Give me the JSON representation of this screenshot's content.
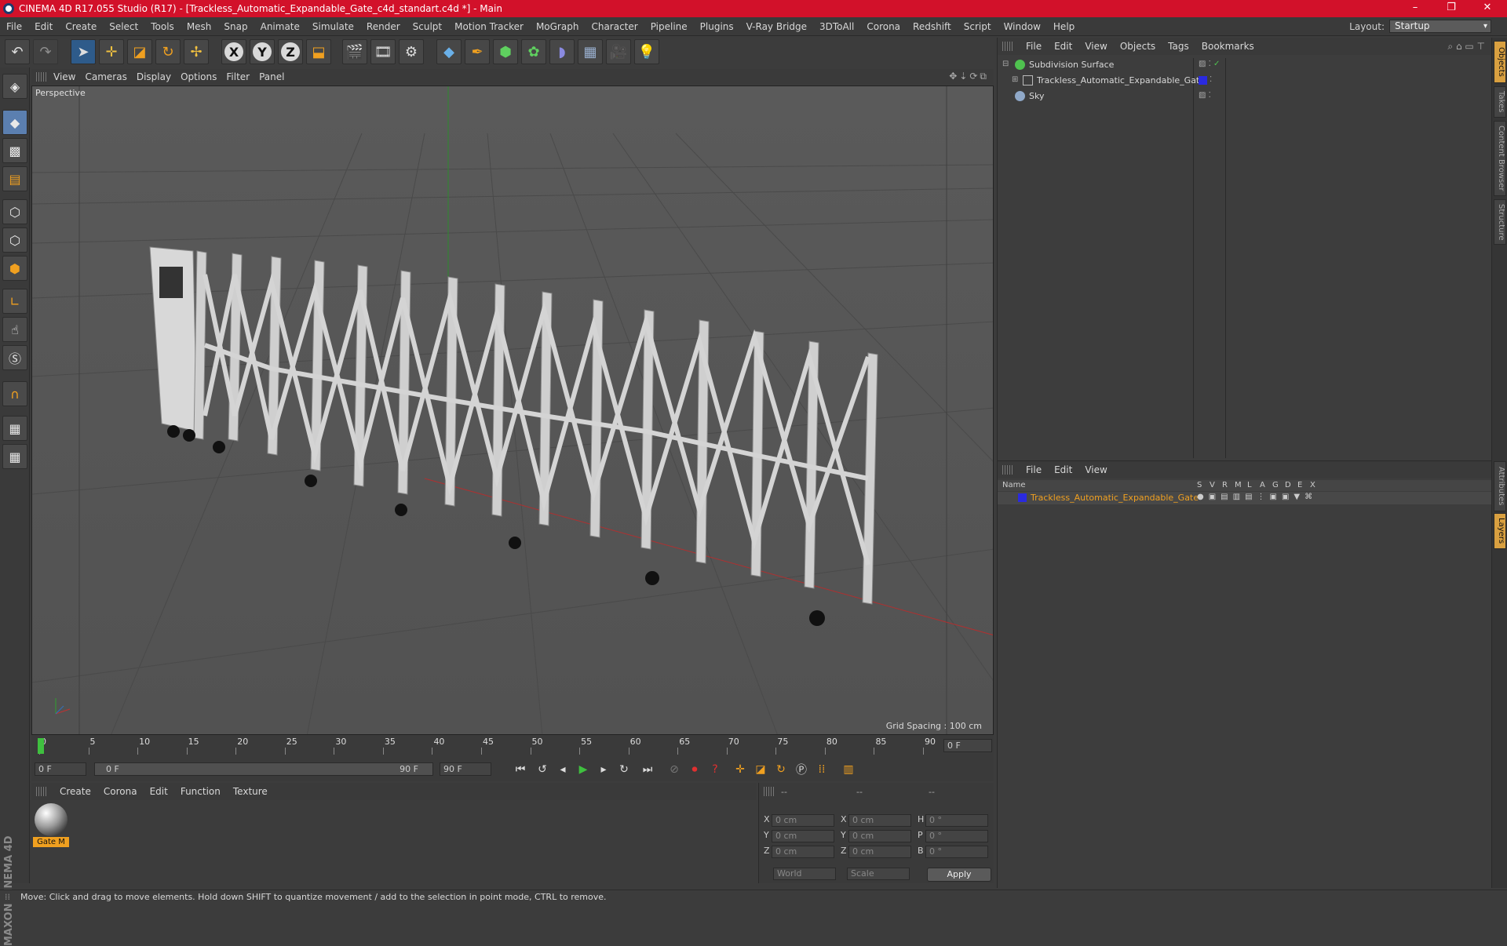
{
  "window": {
    "title": "CINEMA 4D R17.055 Studio (R17) - [Trackless_Automatic_Expandable_Gate_c4d_standart.c4d *] - Main",
    "controls": [
      "–",
      "❐",
      "✕"
    ]
  },
  "menubar": {
    "items": [
      "File",
      "Edit",
      "Create",
      "Select",
      "Tools",
      "Mesh",
      "Snap",
      "Animate",
      "Simulate",
      "Render",
      "Sculpt",
      "Motion Tracker",
      "MoGraph",
      "Character",
      "Pipeline",
      "Plugins",
      "V-Ray Bridge",
      "3DToAll",
      "Corona",
      "Redshift",
      "Script",
      "Window",
      "Help"
    ],
    "layout_label": "Layout:",
    "layout_value": "Startup"
  },
  "toolbar": {
    "axes": [
      "X",
      "Y",
      "Z"
    ]
  },
  "viewport": {
    "menu": [
      "View",
      "Cameras",
      "Display",
      "Options",
      "Filter",
      "Panel"
    ],
    "label": "Perspective",
    "grid_spacing": "Grid Spacing : 100 cm"
  },
  "timeline": {
    "ticks": [
      "0",
      "5",
      "10",
      "15",
      "20",
      "25",
      "30",
      "35",
      "40",
      "45",
      "50",
      "55",
      "60",
      "65",
      "70",
      "75",
      "80",
      "85",
      "90"
    ],
    "current_frame_field": "0 F",
    "start_field": "0 F",
    "range_start": "0 F",
    "range_end": "90 F",
    "end_field": "90 F"
  },
  "materials": {
    "menu": [
      "Create",
      "Corona",
      "Edit",
      "Function",
      "Texture"
    ],
    "items": [
      {
        "name": "Gate M"
      }
    ]
  },
  "coordinates": {
    "headers": [
      "--",
      "--",
      "--"
    ],
    "rows": [
      {
        "axis": "X",
        "pos": "0 cm",
        "axis2": "X",
        "size": "0 cm",
        "rot_label": "H",
        "rot": "0 °"
      },
      {
        "axis": "Y",
        "pos": "0 cm",
        "axis2": "Y",
        "size": "0 cm",
        "rot_label": "P",
        "rot": "0 °"
      },
      {
        "axis": "Z",
        "pos": "0 cm",
        "axis2": "Z",
        "size": "0 cm",
        "rot_label": "B",
        "rot": "0 °"
      }
    ],
    "mode": "World",
    "scale": "Scale",
    "apply": "Apply"
  },
  "objects_panel": {
    "menu": [
      "File",
      "Edit",
      "View",
      "Objects",
      "Tags",
      "Bookmarks"
    ],
    "items": [
      {
        "name": "Subdivision Surface",
        "color": "#4fc24f"
      },
      {
        "name": "Trackless_Automatic_Expandable_Gate",
        "color": "#a0a0a0",
        "tag_color": "#2a2adf"
      },
      {
        "name": "Sky",
        "color": "#8fa8c8"
      }
    ]
  },
  "layers_panel": {
    "menu": [
      "File",
      "Edit",
      "View"
    ],
    "columns": [
      "Name",
      "S",
      "V",
      "R",
      "M",
      "L",
      "A",
      "G",
      "D",
      "E",
      "X"
    ],
    "layer_name": "Trackless_Automatic_Expandable_Gate",
    "layer_color": "#2a2adf"
  },
  "right_tabs": [
    "Objects",
    "Takes",
    "Content Browser",
    "Structure",
    "Attributes",
    "Layers"
  ],
  "statusbar": {
    "text": "Move: Click and drag to move elements. Hold down SHIFT to quantize movement / add to the selection in point mode, CTRL to remove."
  },
  "branding": "MAXON CINEMA 4D"
}
